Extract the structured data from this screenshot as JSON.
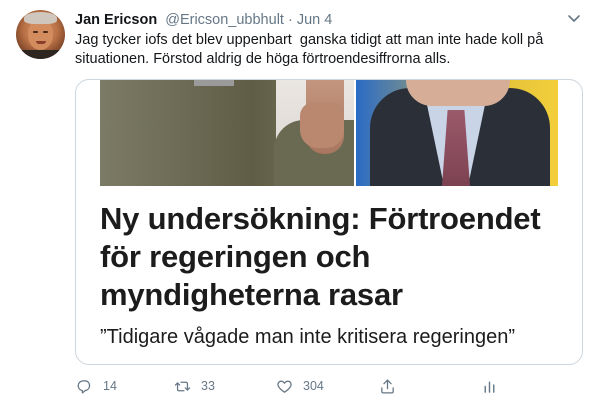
{
  "tweet": {
    "display_name": "Jan Ericson",
    "handle": "@Ericson_ubbhult",
    "separator": "·",
    "date": "Jun 4",
    "text": "Jag tycker iofs det blev uppenbart  ganska tidigt att man inte hade koll på situationen. Förstod aldrig de höga förtroendesiffrorna alls."
  },
  "card": {
    "title": "Ny undersökning: Förtroendet för regeringen och myndigheterna rasar",
    "subtitle": "”Tidigare vågade man inte kritisera regeringen”"
  },
  "actions": {
    "reply_count": "14",
    "retweet_count": "33",
    "like_count": "304"
  },
  "icons": {
    "caret": "chevron-down-icon",
    "reply": "reply-icon",
    "retweet": "retweet-icon",
    "like": "heart-icon",
    "share": "share-icon",
    "analytics": "analytics-icon"
  },
  "colors": {
    "text_primary": "#14171a",
    "text_secondary": "#657786",
    "border": "#ccd6dd"
  }
}
